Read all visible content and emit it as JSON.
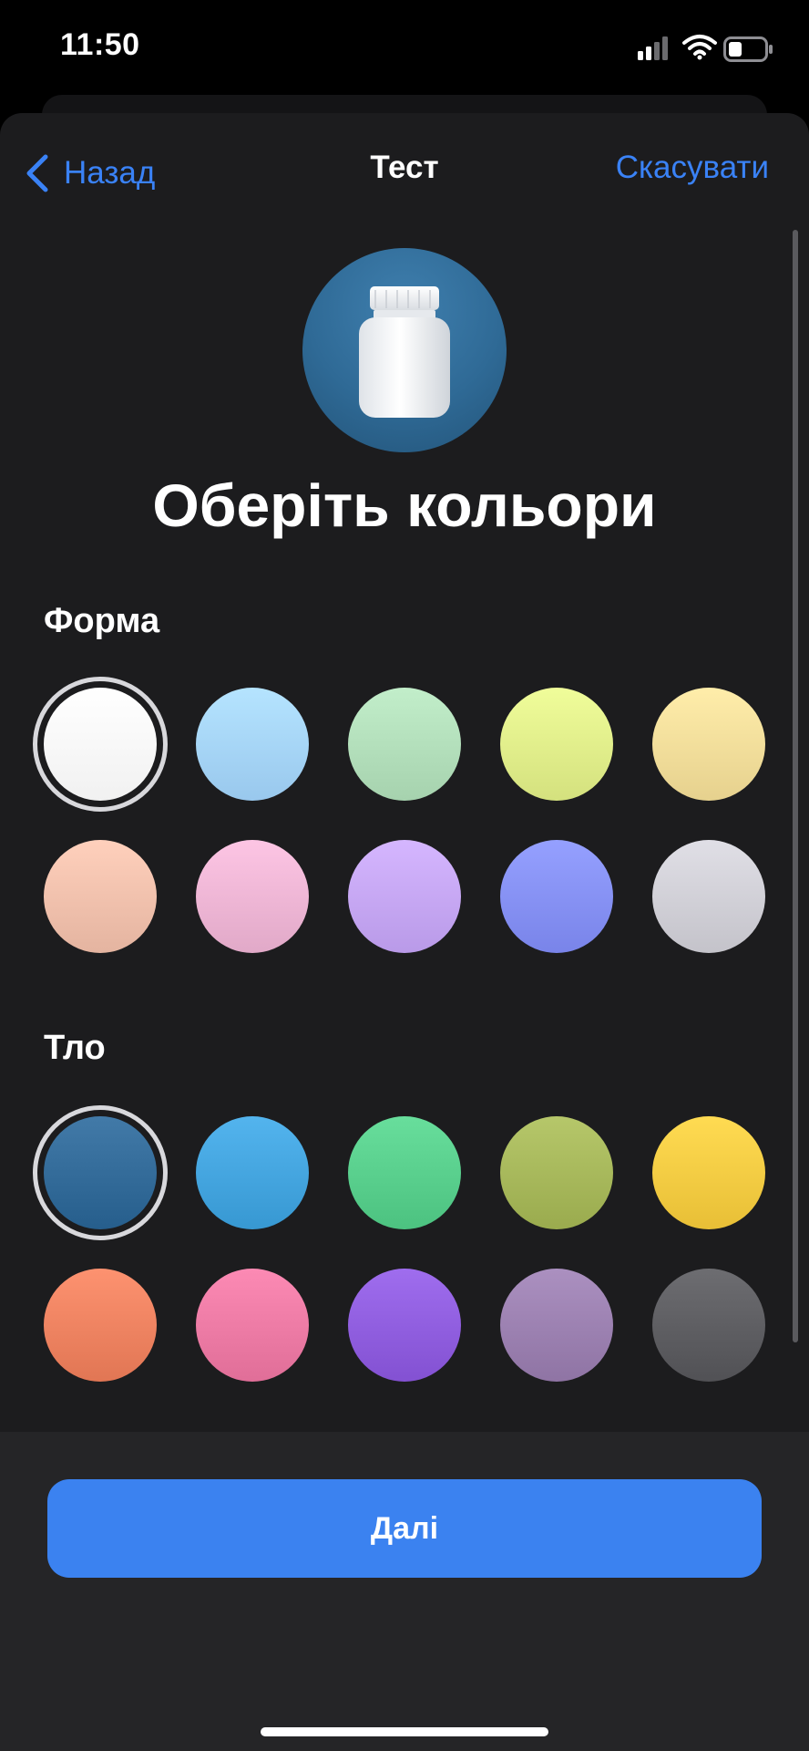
{
  "status_bar": {
    "time": "11:50"
  },
  "nav": {
    "back_label": "Назад",
    "title": "Тест",
    "cancel_label": "Скасувати"
  },
  "hero": {
    "icon": "pill-bottle-icon"
  },
  "page": {
    "heading": "Оберіть кольори"
  },
  "shape_section": {
    "label": "Форма",
    "selected_index": 0,
    "colors": [
      "#ffffff",
      "#a7d6fb",
      "#b4e0bc",
      "#e2ef8c",
      "#f4df9c",
      "#f2c2ae",
      "#efb7d6",
      "#c7a8f6",
      "#8792f7",
      "#d2d1d8"
    ]
  },
  "background_section": {
    "label": "Тло",
    "selected_index": 0,
    "colors": [
      "#346c9a",
      "#45a6e0",
      "#5ad08e",
      "#a8b95c",
      "#f6cd44",
      "#ef8462",
      "#ee7ca6",
      "#915fe0",
      "#9d82b2",
      "#5f5f63"
    ]
  },
  "footer": {
    "next_label": "Далі"
  },
  "colors": {
    "accent": "#3b82f0",
    "sheet_background": "#1c1c1e"
  }
}
